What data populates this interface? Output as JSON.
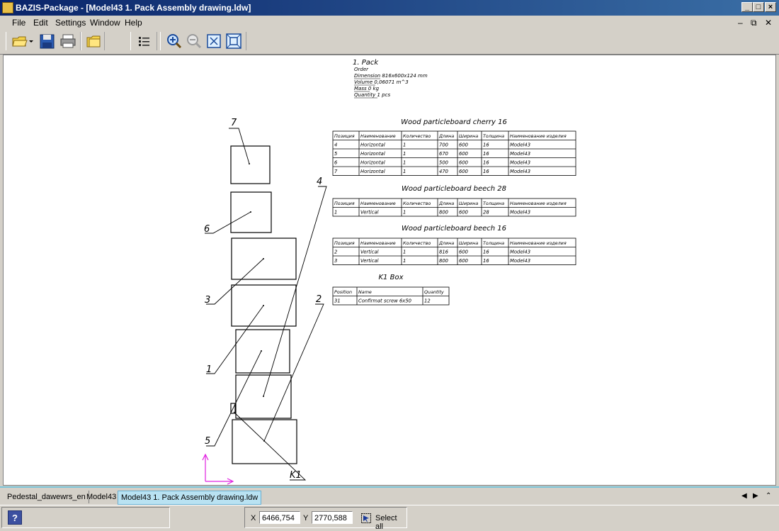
{
  "window": {
    "title": "BAZIS-Package - [Model43 1. Pack Assembly drawing.ldw]"
  },
  "menu": [
    "File",
    "Edit",
    "Settings",
    "Window",
    "Help"
  ],
  "toolbar": {
    "icons": [
      "open-folder-icon",
      "save-icon",
      "print-icon",
      "folder-icon",
      "list-icon",
      "zoom-in-icon",
      "zoom-out-icon",
      "zoom-fit-icon",
      "zoom-window-icon"
    ]
  },
  "drawing": {
    "header": {
      "title": "1. Pack",
      "lines": [
        "Order",
        "Dimension 816x600x124 mm",
        "Volume 0,06071 m^3",
        "Mass 0 kg",
        "Quantity 1 pcs"
      ]
    },
    "callouts": [
      "7",
      "6",
      "4",
      "3",
      "2",
      "1",
      "5",
      "K1"
    ],
    "tables": [
      {
        "title": "Wood particleboard cherry 16",
        "headers": [
          "Позиция",
          "Наименование",
          "Количество",
          "Длина",
          "Ширина",
          "Толщина",
          "Наименование изделия"
        ],
        "rows": [
          [
            "4",
            "Horizontal",
            "1",
            "700",
            "600",
            "16",
            "Model43"
          ],
          [
            "5",
            "Horizontal",
            "1",
            "670",
            "600",
            "16",
            "Model43"
          ],
          [
            "6",
            "Horizontal",
            "1",
            "500",
            "600",
            "16",
            "Model43"
          ],
          [
            "7",
            "Horizontal",
            "1",
            "470",
            "600",
            "16",
            "Model43"
          ]
        ]
      },
      {
        "title": "Wood particleboard beech 28",
        "headers": [
          "Позиция",
          "Наименование",
          "Количество",
          "Длина",
          "Ширина",
          "Толщина",
          "Наименование изделия"
        ],
        "rows": [
          [
            "1",
            "Vertical",
            "1",
            "800",
            "600",
            "28",
            "Model43"
          ]
        ]
      },
      {
        "title": "Wood particleboard beech 16",
        "headers": [
          "Позиция",
          "Наименование",
          "Количество",
          "Длина",
          "Ширина",
          "Толщина",
          "Наименование изделия"
        ],
        "rows": [
          [
            "2",
            "Vertical",
            "1",
            "816",
            "600",
            "16",
            "Model43"
          ],
          [
            "3",
            "Vertical",
            "1",
            "800",
            "600",
            "16",
            "Model43"
          ]
        ]
      },
      {
        "title": "K1 Box",
        "headers": [
          "Position",
          "Name",
          "Quantity"
        ],
        "rows": [
          [
            "31",
            "Confirmat screw 6x50",
            "12"
          ]
        ]
      }
    ]
  },
  "tabs": [
    {
      "label": "Pedestal_dawewrs_en",
      "active": false
    },
    {
      "label": "Model43",
      "active": false
    },
    {
      "label": "Model43 1. Pack Assembly drawing.ldw",
      "active": true
    }
  ],
  "status": {
    "x_label": "X",
    "x_value": "6466,754",
    "y_label": "Y",
    "y_value": "2770,588",
    "select_all": "Select all"
  },
  "colors": {
    "titlebar": "#0a246a",
    "active_tab": "#b9e2f2",
    "axis": "#e020e0"
  }
}
